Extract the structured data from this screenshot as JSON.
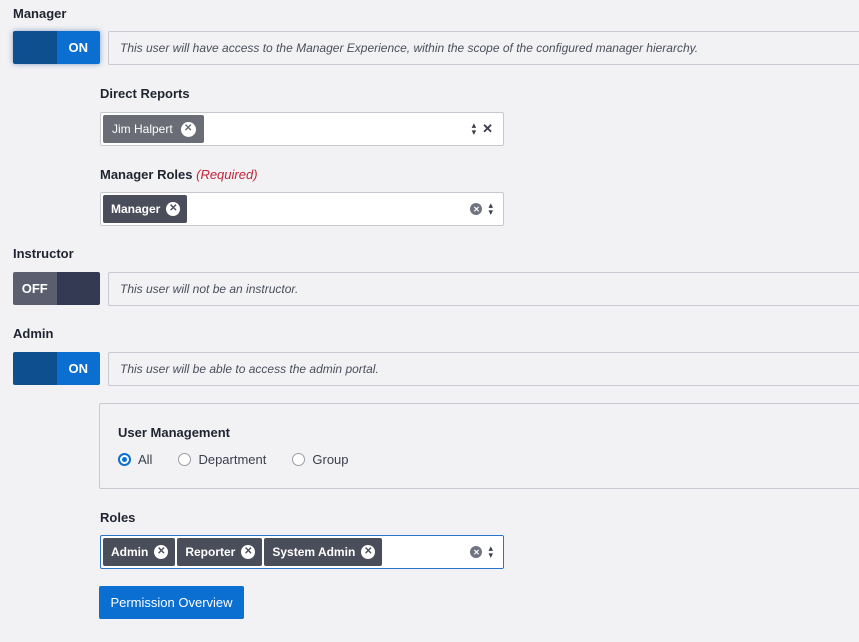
{
  "manager": {
    "label": "Manager",
    "toggle": "ON",
    "description": "This user will have access to the Manager Experience, within the scope of the configured manager hierarchy.",
    "direct_reports": {
      "label": "Direct Reports",
      "tags": [
        "Jim Halpert"
      ]
    },
    "manager_roles": {
      "label": "Manager Roles",
      "required": "(Required)",
      "tags": [
        "Manager"
      ]
    }
  },
  "instructor": {
    "label": "Instructor",
    "toggle": "OFF",
    "description": "This user will not be an instructor."
  },
  "admin": {
    "label": "Admin",
    "toggle": "ON",
    "description": "This user will be able to access the admin portal.",
    "user_management": {
      "label": "User Management",
      "options": [
        "All",
        "Department",
        "Group"
      ],
      "selected": "All"
    },
    "roles": {
      "label": "Roles",
      "tags": [
        "Admin",
        "Reporter",
        "System Admin"
      ]
    }
  },
  "buttons": {
    "permission_overview": "Permission Overview"
  },
  "colors": {
    "primary": "#0a6fd1",
    "toggle_on_left": "#0d4f8f",
    "toggle_off_left": "#5b5e6e",
    "toggle_off_right": "#343a52",
    "required": "#c0243a",
    "background": "#f2f2f5"
  },
  "icons": {
    "tag_remove": "x-circle-icon",
    "clear": "clear-icon",
    "sort": "sort-icon"
  }
}
